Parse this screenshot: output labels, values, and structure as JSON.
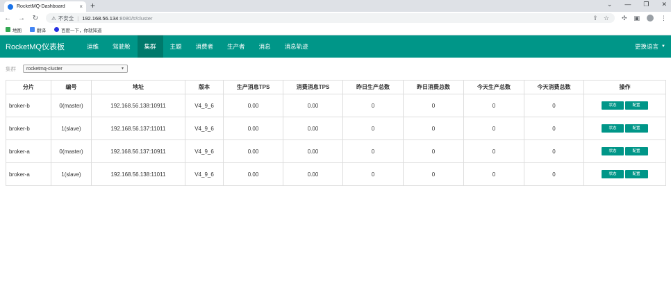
{
  "browser": {
    "tab_title": "RocketMQ-Dashboard",
    "tab_close": "×",
    "new_tab": "+",
    "window_controls": [
      "⌄",
      "—",
      "❐",
      "✕"
    ],
    "nav": {
      "back": "←",
      "forward": "→",
      "reload": "↻"
    },
    "omnibox": {
      "security_icon": "warning-icon",
      "security_text": "不安全",
      "separator": "|",
      "host": "192.168.56.134",
      "path": ":8080/#/cluster"
    },
    "bookmarks": [
      {
        "label": "地图",
        "color": "#34a853"
      },
      {
        "label": "翻译",
        "color": "#4285f4"
      },
      {
        "label": "百度一下，你就知道",
        "color": "#2932e1"
      }
    ]
  },
  "app": {
    "brand": "RocketMQ仪表板",
    "nav_items": [
      "运维",
      "驾驶舱",
      "集群",
      "主题",
      "消费者",
      "生产者",
      "消息",
      "消息轨迹"
    ],
    "active_nav": "集群",
    "language": "更换语言",
    "accent_color": "#009688"
  },
  "filter": {
    "label": "集群",
    "selected": "rocketmq-cluster"
  },
  "table": {
    "headers": [
      "分片",
      "编号",
      "地址",
      "版本",
      "生产消息TPS",
      "消费消息TPS",
      "昨日生产总数",
      "昨日消费总数",
      "今天生产总数",
      "今天消费总数",
      "操作"
    ],
    "rows": [
      [
        "broker-b",
        "0(master)",
        "192.168.56.138:10911",
        "V4_9_6",
        "0.00",
        "0.00",
        "0",
        "0",
        "0",
        "0"
      ],
      [
        "broker-b",
        "1(slave)",
        "192.168.56.137:11011",
        "V4_9_6",
        "0.00",
        "0.00",
        "0",
        "0",
        "0",
        "0"
      ],
      [
        "broker-a",
        "0(master)",
        "192.168.56.137:10911",
        "V4_9_6",
        "0.00",
        "0.00",
        "0",
        "0",
        "0",
        "0"
      ],
      [
        "broker-a",
        "1(slave)",
        "192.168.56.138:11011",
        "V4_9_6",
        "0.00",
        "0.00",
        "0",
        "0",
        "0",
        "0"
      ]
    ],
    "actions": {
      "status": "状态",
      "config": "配置"
    }
  }
}
